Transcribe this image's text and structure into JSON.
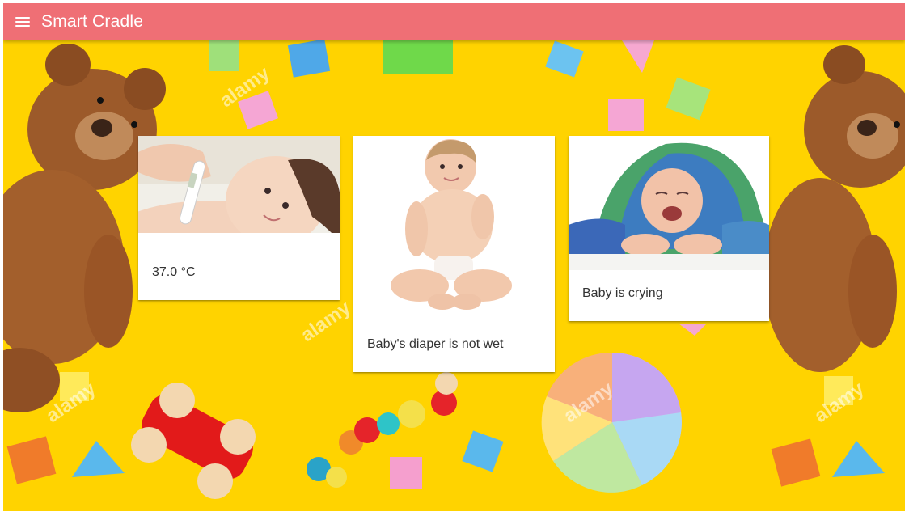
{
  "app": {
    "title": "Smart Cradle",
    "accent_color": "#ef6f75",
    "background_color": "#ffd300"
  },
  "cards": [
    {
      "id": "temperature",
      "label": "37.0 °C",
      "image": "baby-thermometer-photo"
    },
    {
      "id": "diaper",
      "label": "Baby's diaper is not wet",
      "image": "sitting-baby-photo"
    },
    {
      "id": "crying",
      "label": "Baby is crying",
      "image": "crying-baby-towel-photo"
    }
  ],
  "watermark": "alamy"
}
